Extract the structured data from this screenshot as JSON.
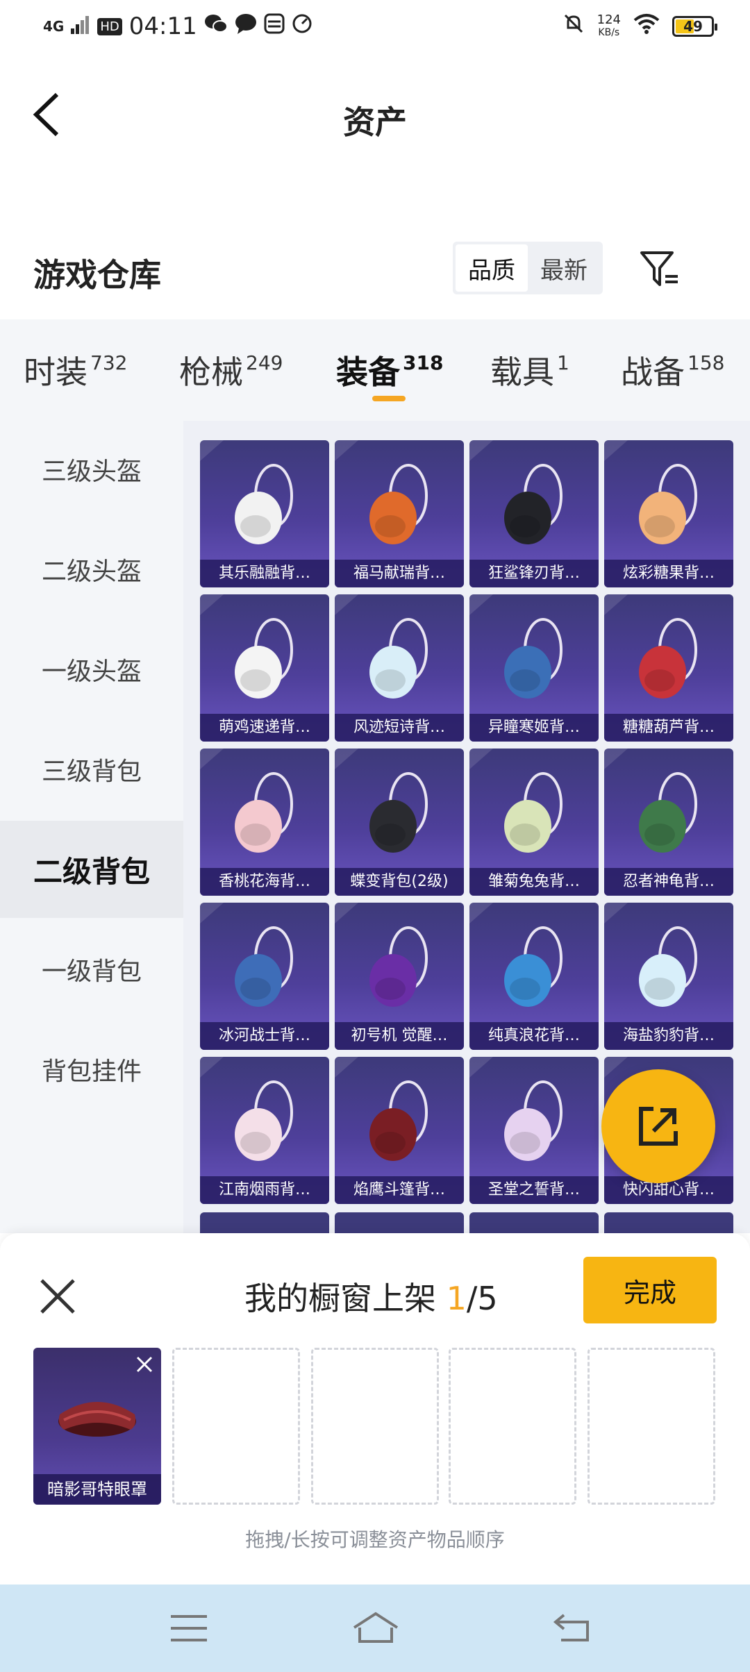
{
  "status_bar": {
    "network": "4G",
    "hd": "HD",
    "time": "04:11",
    "speed_value": "124",
    "speed_unit": "KB/s",
    "battery": "49"
  },
  "nav": {
    "title": "资产"
  },
  "warehouse": {
    "title": "游戏仓库",
    "sort_options": [
      "品质",
      "最新"
    ]
  },
  "tabs": [
    {
      "label": "时装",
      "count": "732"
    },
    {
      "label": "枪械",
      "count": "249"
    },
    {
      "label": "装备",
      "count": "318"
    },
    {
      "label": "载具",
      "count": "1"
    },
    {
      "label": "战备",
      "count": "158"
    }
  ],
  "sidebar": {
    "items": [
      "三级头盔",
      "二级头盔",
      "一级头盔",
      "三级背包",
      "二级背包",
      "一级背包",
      "背包挂件"
    ]
  },
  "items": [
    {
      "label": "其乐融融背…",
      "color": "#f2f2f2"
    },
    {
      "label": "福马献瑞背…",
      "color": "#e06a2b"
    },
    {
      "label": "狂鲨锋刃背…",
      "color": "#222328"
    },
    {
      "label": "炫彩糖果背…",
      "color": "#f2b37a"
    },
    {
      "label": "萌鸡速递背…",
      "color": "#f4f4f4"
    },
    {
      "label": "风迹短诗背…",
      "color": "#d9eef8"
    },
    {
      "label": "异瞳寒姬背…",
      "color": "#3b6fb7"
    },
    {
      "label": "糖糖葫芦背…",
      "color": "#c8333a"
    },
    {
      "label": "香桃花海背…",
      "color": "#f4c9cf"
    },
    {
      "label": "蝶变背包(2级)",
      "color": "#2a2b30"
    },
    {
      "label": "雏菊兔兔背…",
      "color": "#d9e4b8"
    },
    {
      "label": "忍者神龟背…",
      "color": "#3f7a4a"
    },
    {
      "label": "冰河战士背…",
      "color": "#3e6db8"
    },
    {
      "label": "初号机 觉醒…",
      "color": "#6a2ea6"
    },
    {
      "label": "纯真浪花背…",
      "color": "#3a8fd6"
    },
    {
      "label": "海盐豹豹背…",
      "color": "#d8effa"
    },
    {
      "label": "江南烟雨背…",
      "color": "#f4dfe8"
    },
    {
      "label": "焰鹰斗篷背…",
      "color": "#7a1e24"
    },
    {
      "label": "圣堂之誓背…",
      "color": "#e6d2f0"
    },
    {
      "label": "快闪甜心背…",
      "color": "#f3c6d6"
    }
  ],
  "sheet": {
    "title_prefix": "我的橱窗上架 ",
    "current": "1",
    "total": "/5",
    "done_label": "完成",
    "filled_item": "暗影哥特眼罩",
    "hint": "拖拽/长按可调整资产物品顺序"
  },
  "colors": {
    "accent": "#f7b512",
    "card_bg": "#4e3f9a"
  }
}
